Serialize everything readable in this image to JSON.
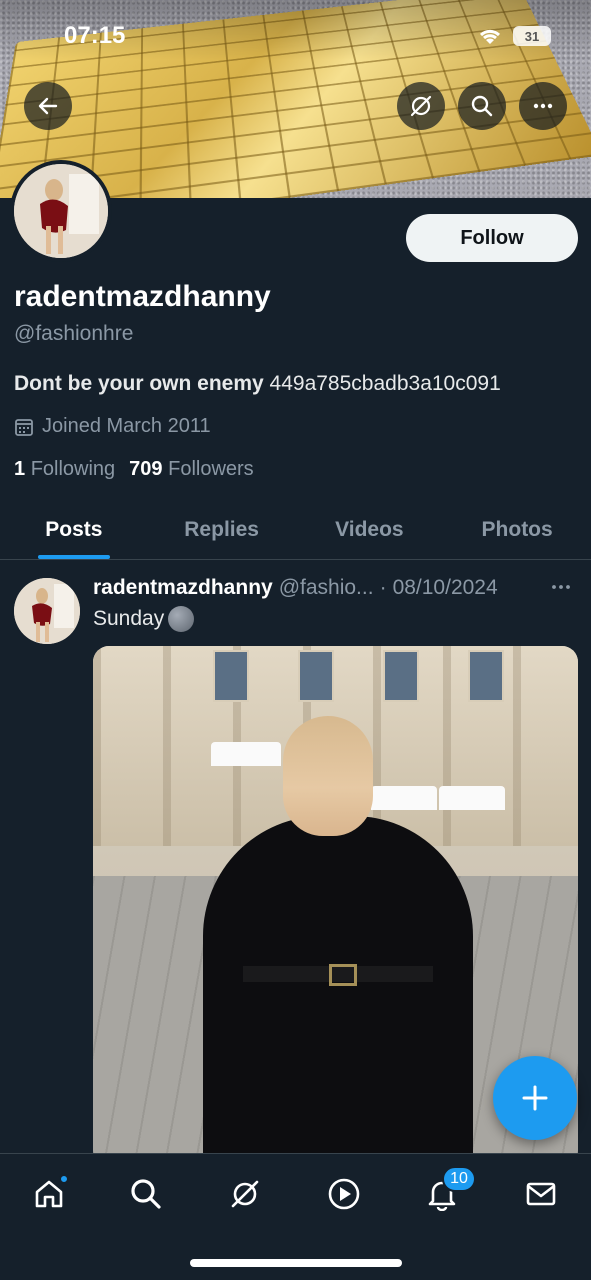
{
  "status_bar": {
    "time": "07:15",
    "battery": "31"
  },
  "profile": {
    "display_name": "radentmazdhanny",
    "handle": "@fashionhre",
    "bio_bold": "Dont be your own enemy",
    "bio_rest": " 449a785cbadb3a10c091",
    "joined": "Joined March 2011",
    "following_count": "1",
    "following_label": "Following",
    "followers_count": "709",
    "followers_label": "Followers",
    "follow_button": "Follow"
  },
  "tabs": [
    {
      "label": "Posts",
      "active": true
    },
    {
      "label": "Replies",
      "active": false
    },
    {
      "label": "Videos",
      "active": false
    },
    {
      "label": "Photos",
      "active": false
    }
  ],
  "post": {
    "author_name": "radentmazdhanny",
    "author_handle": "@fashio...",
    "separator": "·",
    "date": "08/10/2024",
    "text": "Sunday"
  },
  "bottom_nav": {
    "items": [
      "home-icon",
      "search-icon",
      "grok-icon",
      "play-icon",
      "bell-icon",
      "mail-icon"
    ],
    "notifications_badge": "10"
  },
  "colors": {
    "accent": "#1d9bf0",
    "background": "#15202b",
    "muted": "#8b98a5"
  }
}
